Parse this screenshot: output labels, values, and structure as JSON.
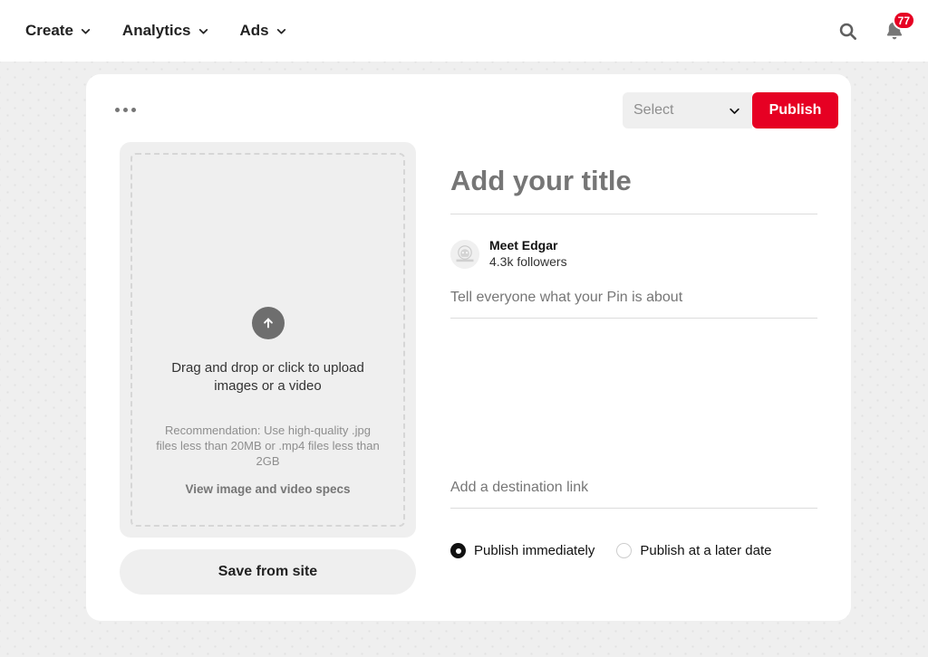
{
  "topbar": {
    "nav_items": [
      {
        "label": "Create",
        "icon": "chevron-down-icon"
      },
      {
        "label": "Analytics",
        "icon": "chevron-down-icon"
      },
      {
        "label": "Ads",
        "icon": "chevron-down-icon"
      }
    ],
    "search_icon": "search-icon",
    "notifications_icon": "bell-icon",
    "notification_count": "77"
  },
  "card": {
    "more_options_label": "more-options",
    "select": {
      "value": "Select",
      "icon": "chevron-down-icon"
    },
    "publish_label": "Publish"
  },
  "uploader": {
    "upload_icon": "upload-arrow-icon",
    "drop_text": "Drag and drop or click to upload images or a video",
    "recommendation": "Recommendation: Use high-quality .jpg files less than 20MB or .mp4 files less than 2GB",
    "specs_link": "View image and video specs",
    "save_from_site_label": "Save from site"
  },
  "form": {
    "title_placeholder": "Add your title",
    "title_value": "",
    "author": {
      "name": "Meet Edgar",
      "followers": "4.3k followers",
      "avatar": "avatar-meet-edgar"
    },
    "description_placeholder": "Tell everyone what your Pin is about",
    "description_value": "",
    "link_placeholder": "Add a destination link",
    "link_value": "",
    "schedule_options": [
      {
        "label": "Publish immediately",
        "selected": true
      },
      {
        "label": "Publish at a later date",
        "selected": false
      }
    ]
  },
  "colors": {
    "brand_red": "#e60023",
    "page_background": "#efefef",
    "card_background": "#ffffff",
    "muted_text": "#767676"
  }
}
